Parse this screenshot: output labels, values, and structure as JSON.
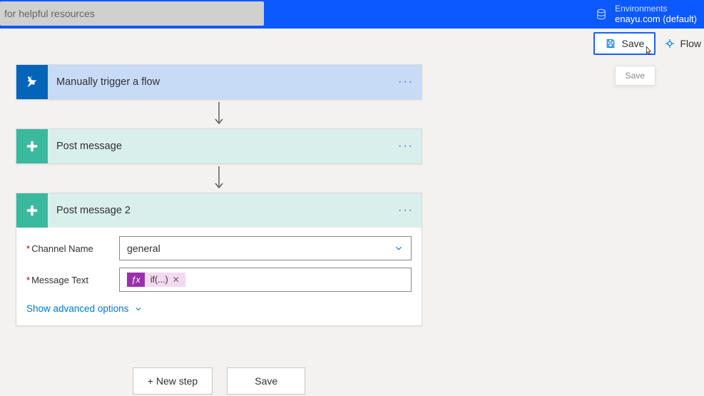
{
  "header": {
    "search_placeholder": "for helpful resources",
    "env_label": "Environments",
    "env_name": "enayu.com (default)"
  },
  "toolbar": {
    "save_label": "Save",
    "flow_label": "Flow",
    "tooltip": "Save"
  },
  "flow": {
    "trigger": {
      "title": "Manually trigger a flow"
    },
    "action1": {
      "title": "Post message"
    },
    "action2": {
      "title": "Post message 2",
      "fields": {
        "channel_label": "Channel Name",
        "channel_value": "general",
        "message_label": "Message Text",
        "expression_token": "if(...)"
      },
      "advanced_label": "Show advanced options"
    }
  },
  "footer": {
    "new_step_label": "+ New step",
    "save_label": "Save"
  }
}
